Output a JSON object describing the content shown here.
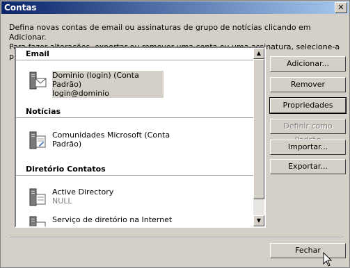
{
  "window": {
    "title": "Contas",
    "close_glyph": "✕"
  },
  "description": {
    "line1": "Defina novas contas de email ou assinaturas de grupo de notícias clicando em Adicionar.",
    "line2": "Para fazer alterações, exportar ou remover uma conta ou uma assinatura, selecione-a primeiro."
  },
  "list": {
    "groups": [
      {
        "header": "Email",
        "items": [
          {
            "name": "Dominio (login) (Conta Padrão)",
            "detail": "login@dominio",
            "icon": "mail-server-icon"
          }
        ]
      },
      {
        "header": "Notícias",
        "items": [
          {
            "name": "Comunidades Microsoft (Conta",
            "name2": "Padrão)",
            "icon": "news-server-icon"
          }
        ]
      },
      {
        "header": "Diretório Contatos",
        "items": [
          {
            "name": "Active Directory",
            "detail": "NULL",
            "icon": "directory-server-icon"
          },
          {
            "name": "Serviço de diretório na Internet",
            "icon": "directory-server-icon"
          }
        ]
      }
    ]
  },
  "buttons": {
    "add": "Adicionar...",
    "remove": "Remover",
    "properties": "Propriedades",
    "set_default": "Definir como Padrão",
    "import": "Importar...",
    "export": "Exportar...",
    "close": "Fechar"
  },
  "colors": {
    "title_start": "#0a246a",
    "title_end": "#a6caf0",
    "face": "#d4d0c8"
  }
}
